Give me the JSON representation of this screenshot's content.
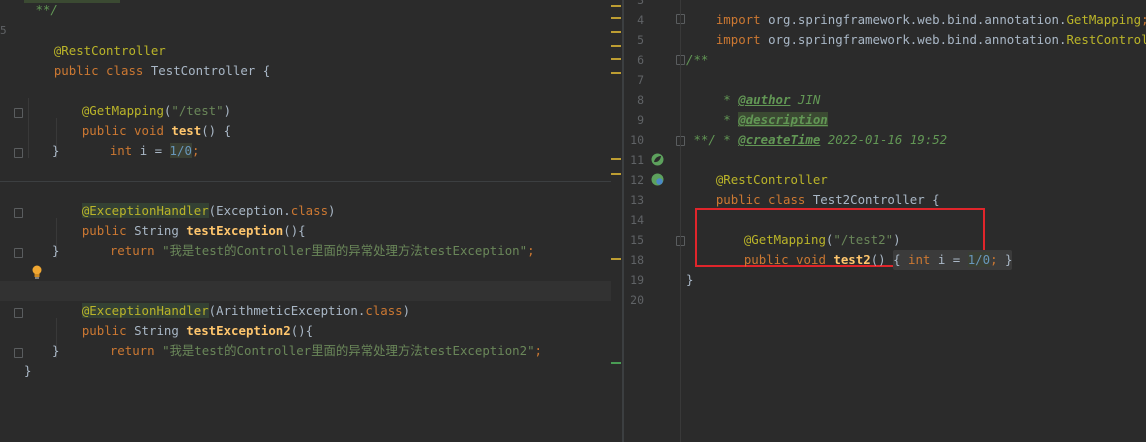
{
  "left": {
    "doc_comment_end": " **/",
    "rest_controller": "@RestController",
    "class_decl": {
      "kw": "public class ",
      "name": "TestController {"
    },
    "methods": [
      {
        "annotation": "@GetMapping",
        "annotation_args_open": "(",
        "annotation_args_str": "\"/test\"",
        "annotation_args_close": ")",
        "sig_kw": "public void ",
        "sig_name": "test",
        "sig_rest": "() {",
        "body_kw": "int",
        "body_mid": " i = ",
        "body_num": "1/0",
        "body_end": ";",
        "close": "}"
      }
    ],
    "handler1": {
      "annotation": "@ExceptionHandler",
      "arg_open": "(Exception.",
      "arg_kw": "class",
      "arg_close": ")",
      "sig_kw": "public ",
      "sig_type": "String ",
      "sig_name": "testException",
      "sig_rest": "(){",
      "ret_kw": "return ",
      "ret_str": "\"我是test的Controller里面的异常处理方法testException\"",
      "ret_end": ";",
      "close": "}"
    },
    "handler2": {
      "annotation": "@ExceptionHandler",
      "arg_open": "(ArithmeticException.",
      "arg_kw": "class",
      "arg_close": ")",
      "sig_kw": "public ",
      "sig_type": "String ",
      "sig_name": "testException2",
      "sig_rest": "(){",
      "ret_kw": "return ",
      "ret_str": "\"我是test的Controller里面的异常处理方法testException2\"",
      "ret_end": ";",
      "close": "}"
    },
    "class_close": "}",
    "cut_gutter_digit": "5"
  },
  "right": {
    "line_numbers": [
      "3",
      "4",
      "5",
      "6",
      "7",
      "8",
      "9",
      "10",
      "11",
      "12",
      "13",
      "14",
      "15",
      "18",
      "19",
      "20"
    ],
    "import1": {
      "kw": "import ",
      "path": "org.springframework.web.bind.annotation.",
      "cls": "GetMapping",
      "end": ";"
    },
    "import2": {
      "kw": "import ",
      "path": "org.springframework.web.bind.annotation.",
      "cls": "RestController",
      "end": ";"
    },
    "doc_open": "/**",
    "doc_author_star": " * ",
    "doc_author_tag": "@author",
    "doc_author_val": " JIN",
    "doc_desc_star": " * ",
    "doc_desc_tag": "@description",
    "doc_ct_star": " * ",
    "doc_ct_tag": "@createTime",
    "doc_ct_val": " 2022-01-16 19:52",
    "doc_close": " **/",
    "rest_controller": "@RestController",
    "class_kw": "public class ",
    "class_name": "Test2Controller {",
    "get_annotation": "@GetMapping",
    "get_open": "(",
    "get_str": "\"/test2\"",
    "get_close": ")",
    "sig_kw": "public void ",
    "sig_name": "test2",
    "sig_rest": "() ",
    "fold_open": "{ ",
    "body_kw": "int",
    "body_mid": " i = ",
    "body_num": "1/0",
    "body_end": ";",
    "fold_close": " }",
    "class_close": "}"
  },
  "colors": {
    "background": "#2b2b2b",
    "keyword": "#cc7832",
    "annotation": "#bbb529",
    "string": "#6a8759",
    "number": "#6897bb",
    "highlight_box": "#e0252b"
  }
}
